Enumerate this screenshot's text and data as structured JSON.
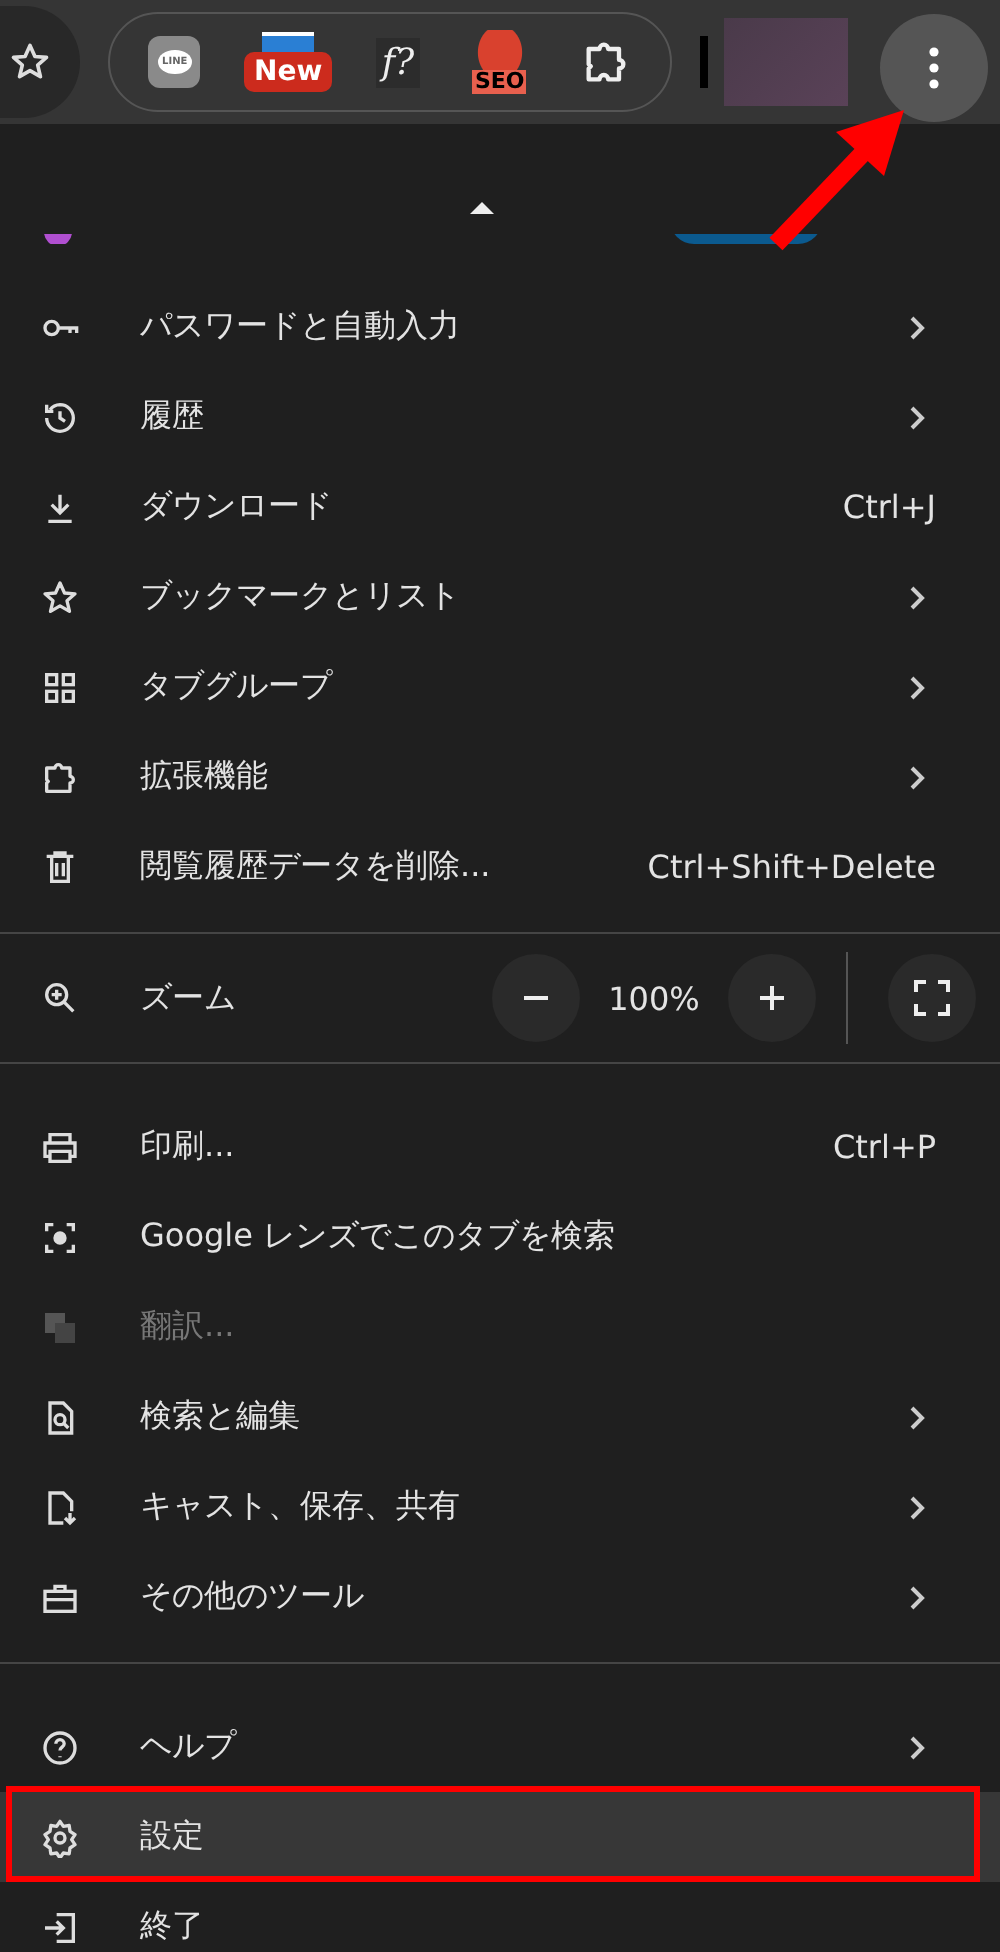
{
  "toolbar": {
    "extensions": [
      {
        "kind": "line",
        "label": "LINE"
      },
      {
        "kind": "new",
        "label": "New"
      },
      {
        "kind": "formula",
        "label": "f?"
      },
      {
        "kind": "seo",
        "label": "SEO"
      },
      {
        "kind": "puzzle"
      }
    ]
  },
  "pointer_arrow": true,
  "menu": {
    "sections": [
      {
        "kind": "items",
        "items": [
          {
            "label": "パスワードと自動入力",
            "submenu": true,
            "disabled": false,
            "highlighted": false,
            "outlined": false
          },
          {
            "label": "履歴",
            "submenu": true,
            "disabled": false,
            "highlighted": false,
            "outlined": false
          },
          {
            "label": "ダウンロード",
            "shortcut": "Ctrl+J",
            "submenu": false,
            "disabled": false,
            "highlighted": false,
            "outlined": false
          },
          {
            "label": "ブックマークとリスト",
            "submenu": true,
            "disabled": false,
            "highlighted": false,
            "outlined": false
          },
          {
            "label": "タブグループ",
            "submenu": true,
            "disabled": false,
            "highlighted": false,
            "outlined": false
          },
          {
            "label": "拡張機能",
            "submenu": true,
            "disabled": false,
            "highlighted": false,
            "outlined": false
          },
          {
            "label": "閲覧履歴データを削除...",
            "shortcut": "Ctrl+Shift+Delete",
            "submenu": false,
            "disabled": false,
            "highlighted": false,
            "outlined": false
          }
        ]
      },
      {
        "kind": "zoom",
        "label": "ズーム",
        "value": "100%"
      },
      {
        "kind": "items",
        "items": [
          {
            "label": "印刷...",
            "shortcut": "Ctrl+P",
            "submenu": false,
            "disabled": false,
            "highlighted": false,
            "outlined": false
          },
          {
            "label": "Google レンズでこのタブを検索",
            "submenu": false,
            "disabled": false,
            "highlighted": false,
            "outlined": false
          },
          {
            "label": "翻訳...",
            "submenu": false,
            "disabled": true,
            "highlighted": false,
            "outlined": false
          },
          {
            "label": "検索と編集",
            "submenu": true,
            "disabled": false,
            "highlighted": false,
            "outlined": false
          },
          {
            "label": "キャスト、保存、共有",
            "submenu": true,
            "disabled": false,
            "highlighted": false,
            "outlined": false
          },
          {
            "label": "その他のツール",
            "submenu": true,
            "disabled": false,
            "highlighted": false,
            "outlined": false
          }
        ]
      },
      {
        "kind": "items",
        "items": [
          {
            "label": "ヘルプ",
            "submenu": true,
            "disabled": false,
            "highlighted": false,
            "outlined": false
          },
          {
            "label": "設定",
            "submenu": false,
            "disabled": false,
            "highlighted": true,
            "outlined": true
          },
          {
            "label": "終了",
            "submenu": false,
            "disabled": false,
            "highlighted": false,
            "outlined": false
          }
        ]
      }
    ]
  }
}
